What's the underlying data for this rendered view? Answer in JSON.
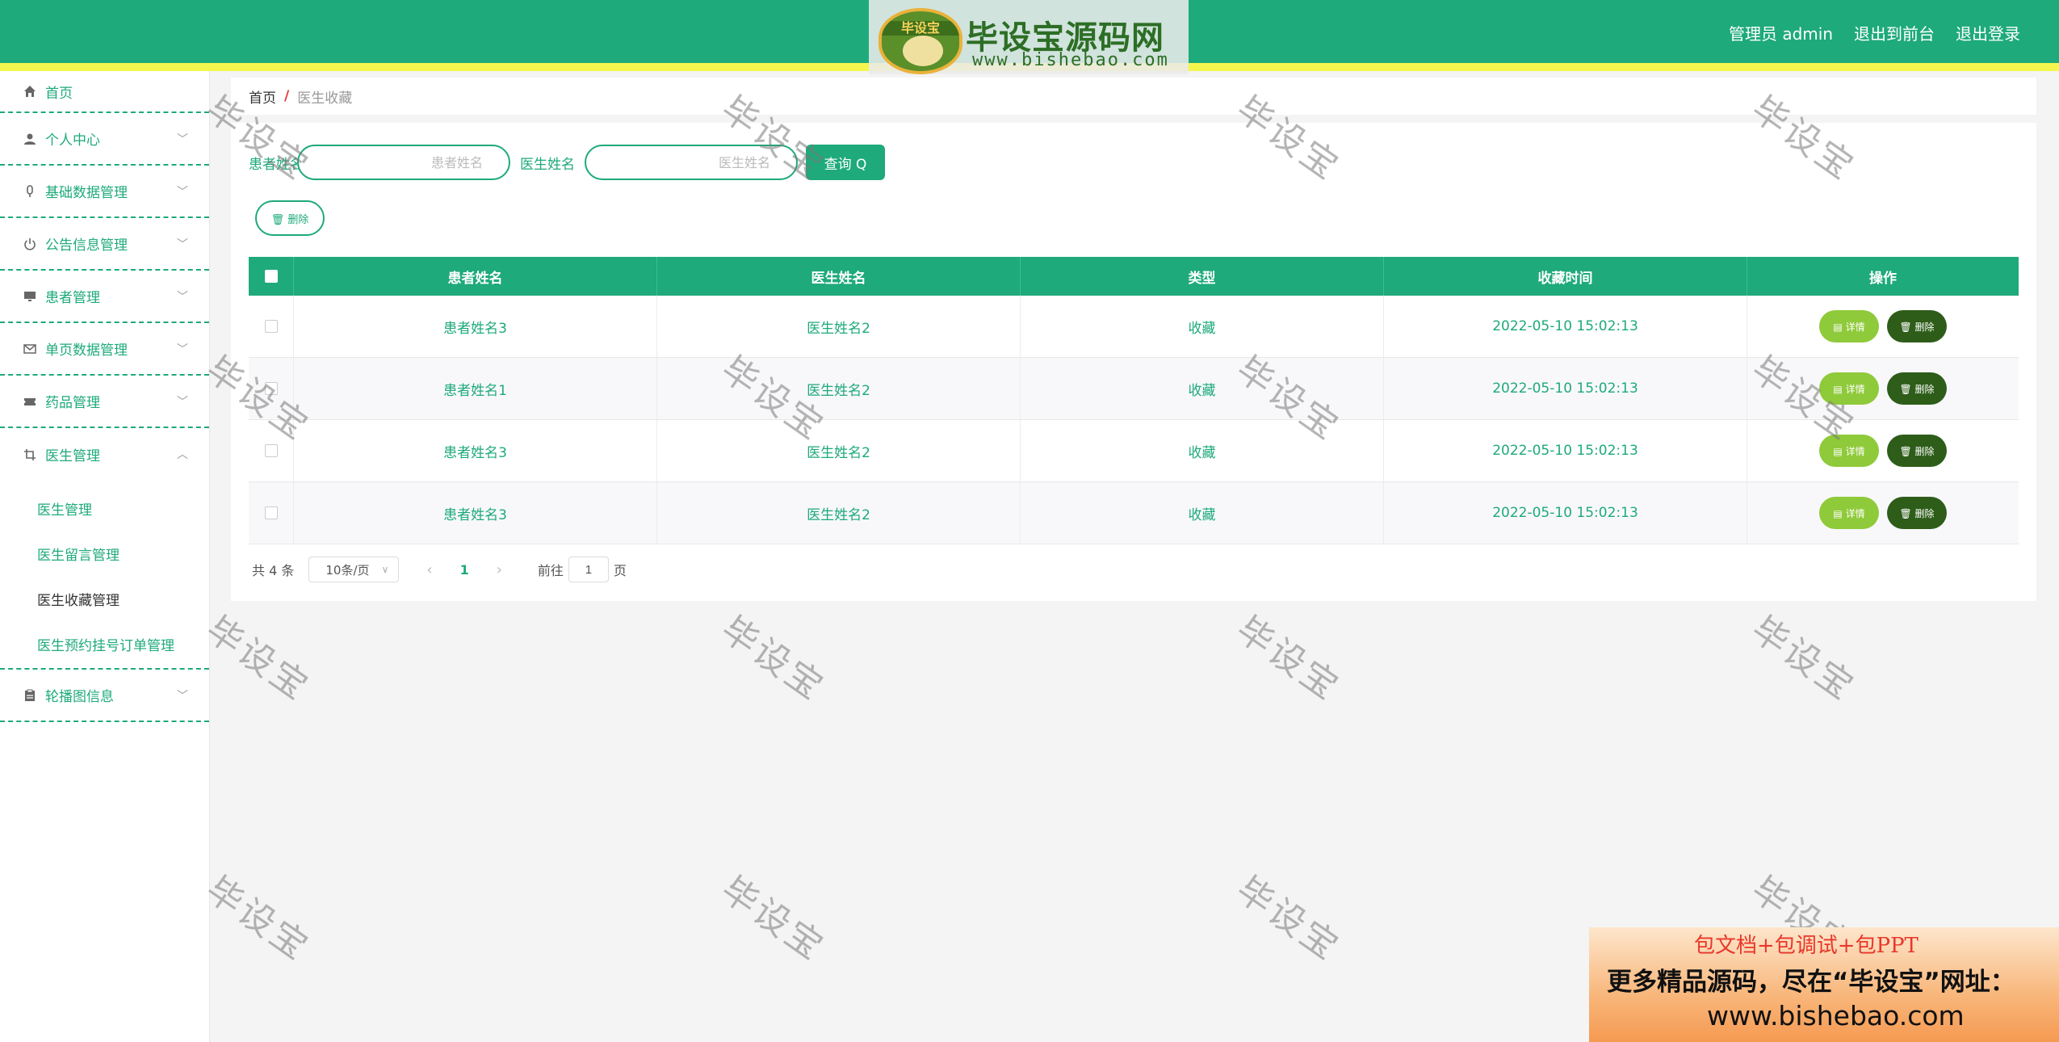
{
  "header": {
    "admin_label": "管理员 admin",
    "frontend_link": "退出到前台",
    "logout_link": "退出登录"
  },
  "logo": {
    "badge_text": "毕设宝",
    "title": "毕设宝源码网",
    "url": "www.bishebao.com"
  },
  "sidebar": {
    "home": "首页",
    "items": [
      {
        "label": "个人中心",
        "icon": "user-icon"
      },
      {
        "label": "基础数据管理",
        "icon": "mic-icon"
      },
      {
        "label": "公告信息管理",
        "icon": "power-icon"
      },
      {
        "label": "患者管理",
        "icon": "monitor-icon"
      },
      {
        "label": "单页数据管理",
        "icon": "mail-icon"
      },
      {
        "label": "药品管理",
        "icon": "ticket-icon"
      },
      {
        "label": "医生管理",
        "icon": "crop-icon"
      }
    ],
    "sub_items": [
      "医生管理",
      "医生留言管理",
      "医生收藏管理",
      "医生预约挂号订单管理"
    ],
    "last_item": {
      "label": "轮播图信息",
      "icon": "clipboard-icon"
    }
  },
  "breadcrumb": {
    "home": "首页",
    "separator": "/",
    "current": "医生收藏"
  },
  "search": {
    "patient_label": "患者姓名",
    "patient_placeholder": "患者姓名",
    "doctor_label": "医生姓名",
    "doctor_placeholder": "医生姓名",
    "query_button": "查询 Q"
  },
  "delete_button": "删除",
  "table": {
    "headers": [
      "患者姓名",
      "医生姓名",
      "类型",
      "收藏时间",
      "操作"
    ],
    "rows": [
      {
        "patient": "患者姓名3",
        "doctor": "医生姓名2",
        "type": "收藏",
        "time": "2022-05-10 15:02:13"
      },
      {
        "patient": "患者姓名1",
        "doctor": "医生姓名2",
        "type": "收藏",
        "time": "2022-05-10 15:02:13"
      },
      {
        "patient": "患者姓名3",
        "doctor": "医生姓名2",
        "type": "收藏",
        "time": "2022-05-10 15:02:13"
      },
      {
        "patient": "患者姓名3",
        "doctor": "医生姓名2",
        "type": "收藏",
        "time": "2022-05-10 15:02:13"
      }
    ],
    "detail_label": "详情",
    "delete_label": "删除"
  },
  "pager": {
    "total": "共 4 条",
    "page_size": "10条/页",
    "current_page": "1",
    "goto_label": "前往",
    "goto_value": "1",
    "page_unit": "页"
  },
  "watermark": "毕设宝",
  "ad": {
    "line1": "包文档+包调试+包PPT",
    "line2": "更多精品源码，尽在“毕设宝”网址：",
    "line3": "www.bishebao.com"
  },
  "colors": {
    "primary": "#1eaa7a",
    "stripe": "#f4f64e",
    "detail_btn": "#8fca3a",
    "delete_btn": "#2e5d1a"
  }
}
